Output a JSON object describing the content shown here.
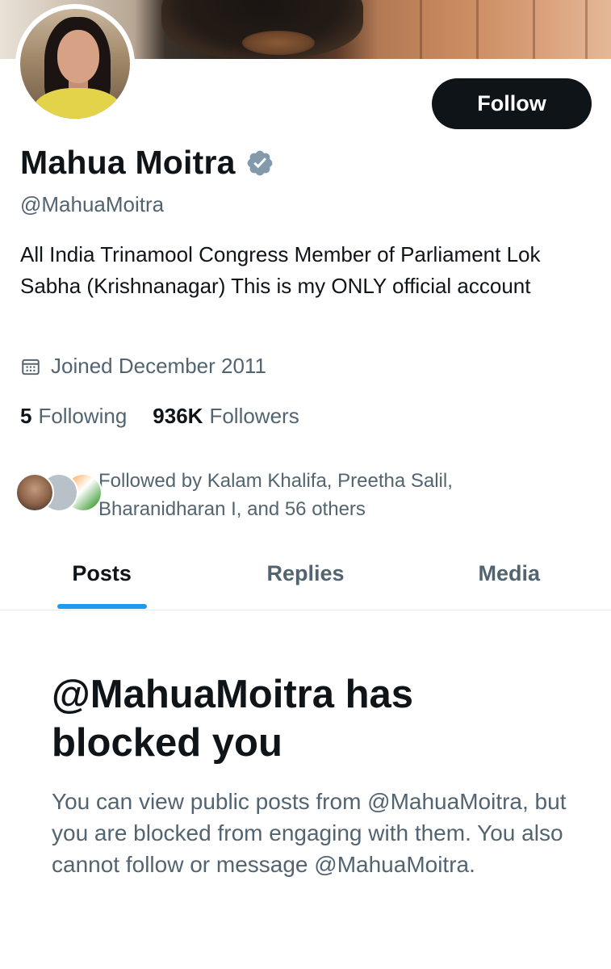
{
  "profile": {
    "name": "Mahua Moitra",
    "handle": "@MahuaMoitra",
    "bio": "All India Trinamool Congress Member of Parliament Lok Sabha (Krishnanagar) This is my ONLY official account",
    "joined": "Joined December 2011",
    "verified_icon": "verified-badge-icon",
    "calendar_icon": "calendar-icon"
  },
  "actions": {
    "follow_label": "Follow"
  },
  "stats": {
    "following_count": "5",
    "following_label": "Following",
    "followers_count": "936K",
    "followers_label": "Followers"
  },
  "followed_by": {
    "text": "Followed by Kalam Khalifa, Preetha Salil, Bharanidharan I, and 56 others"
  },
  "tabs": [
    {
      "label": "Posts",
      "active": true
    },
    {
      "label": "Replies",
      "active": false
    },
    {
      "label": "Media",
      "active": false
    }
  ],
  "blocked": {
    "title": "@MahuaMoitra has blocked you",
    "description": "You can view public posts from @MahuaMoitra, but you are blocked from engaging with them. You also cannot follow or message @MahuaMoitra."
  },
  "colors": {
    "accent": "#1d9bf0",
    "text_primary": "#0f1419",
    "text_secondary": "#536471",
    "verified": "#829aab"
  }
}
